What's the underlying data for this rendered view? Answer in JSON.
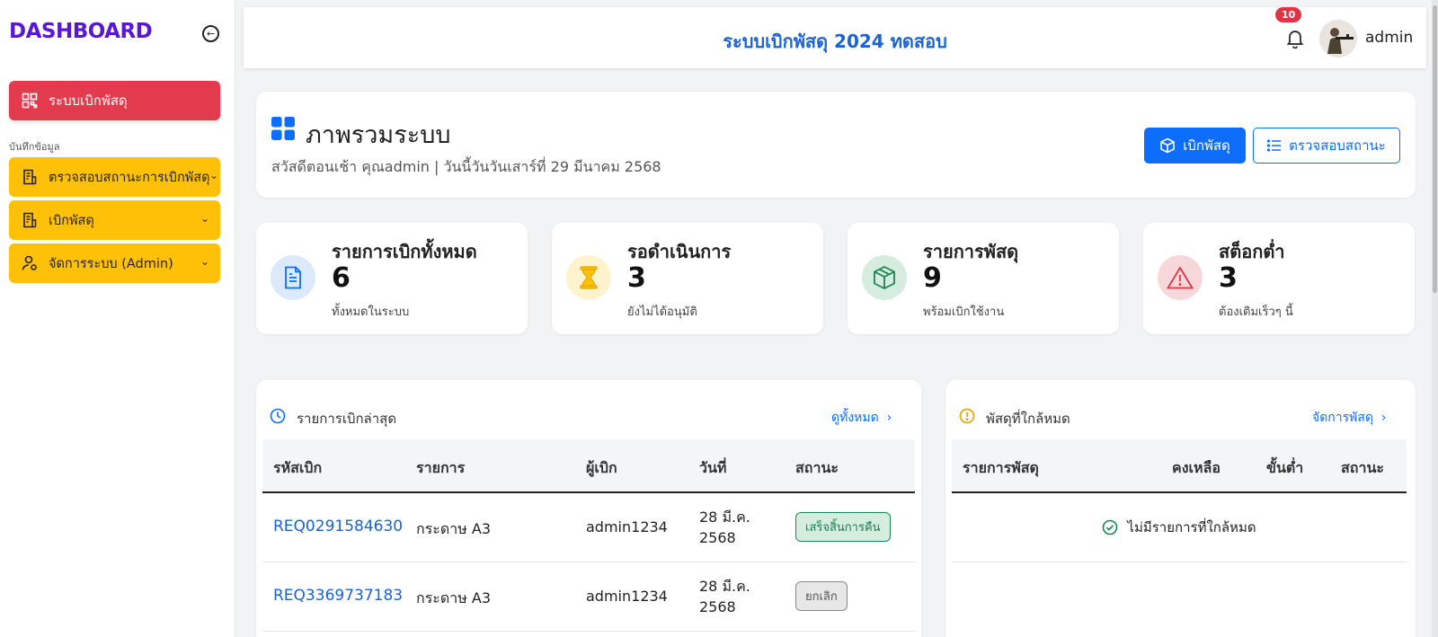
{
  "sidebar": {
    "brand": "DASHBOARD",
    "main_item": "ระบบเบิกพัสดุ",
    "section_label": "บันทึกข้อมูล",
    "items": [
      {
        "label": "ตรวจสอบสถานะการเบิกพัสดุ",
        "icon": "document-list-icon"
      },
      {
        "label": "เบิกพัสดุ",
        "icon": "document-list-icon"
      },
      {
        "label": "จัดการระบบ (Admin)",
        "icon": "user-settings-icon"
      }
    ]
  },
  "header": {
    "title": "ระบบเบิกพัสดุ 2024 ทดสอบ",
    "notification_count": "10",
    "username": "admin"
  },
  "overview": {
    "title": "ภาพรวมระบบ",
    "subtitle": "สวัสดีตอนเช้า คุณadmin | วันนี้วันวันเสาร์ที่ 29 มีนาคม 2568",
    "primary_button": "เบิกพัสดุ",
    "secondary_button": "ตรวจสอบสถานะ"
  },
  "stats": [
    {
      "label": "รายการเบิกทั้งหมด",
      "value": "6",
      "note": "ทั้งหมดในระบบ",
      "color": "#0d6efd"
    },
    {
      "label": "รอดำเนินการ",
      "value": "3",
      "note": "ยังไม่ได้อนุมัติ",
      "color": "#ffc107"
    },
    {
      "label": "รายการพัสดุ",
      "value": "9",
      "note": "พร้อมเบิกใช้งาน",
      "color": "#198754"
    },
    {
      "label": "สต็อกต่ำ",
      "value": "3",
      "note": "ต้องเติมเร็วๆ นี้",
      "color": "#dc3545"
    }
  ],
  "recent": {
    "title": "รายการเบิกล่าสุด",
    "view_all": "ดูทั้งหมด",
    "columns": [
      "รหัสเบิก",
      "รายการ",
      "ผู้เบิก",
      "วันที่",
      "สถานะ"
    ],
    "rows": [
      {
        "code": "REQ0291584630",
        "item": "กระดาษ A3",
        "user": "admin1234",
        "date1": "28 มี.ค.",
        "date2": "2568",
        "status": "เสร็จสิ้นการคืน"
      },
      {
        "code": "REQ3369737183",
        "item": "กระดาษ A3",
        "user": "admin1234",
        "date1": "28 มี.ค.",
        "date2": "2568",
        "status": "ยกเลิก"
      }
    ]
  },
  "low_stock": {
    "title": "พัสดุที่ใกล้หมด",
    "manage": "จัดการพัสดุ",
    "columns": [
      "รายการพัสดุ",
      "คงเหลือ",
      "ขั้นต่ำ",
      "สถานะ"
    ],
    "empty_text": "ไม่มีรายการที่ใกล้หมด"
  }
}
